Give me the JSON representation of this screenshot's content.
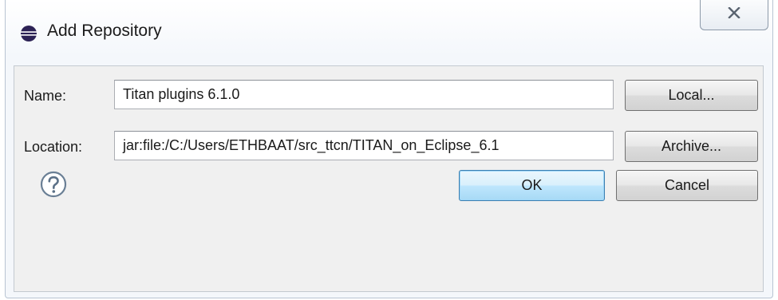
{
  "window": {
    "title": "Add Repository"
  },
  "form": {
    "name_label": "Name:",
    "name_value": "Titan plugins 6.1.0",
    "location_label": "Location:",
    "location_value": "jar:file:/C:/Users/ETHBAAT/src_ttcn/TITAN_on_Eclipse_6.1"
  },
  "buttons": {
    "local": "Local...",
    "archive": "Archive...",
    "ok": "OK",
    "cancel": "Cancel"
  },
  "icons": {
    "app": "eclipse-icon",
    "close": "close-icon",
    "help": "help-icon"
  },
  "colors": {
    "default_button": "#bee6fd",
    "help_icon": "#6a7f95"
  }
}
